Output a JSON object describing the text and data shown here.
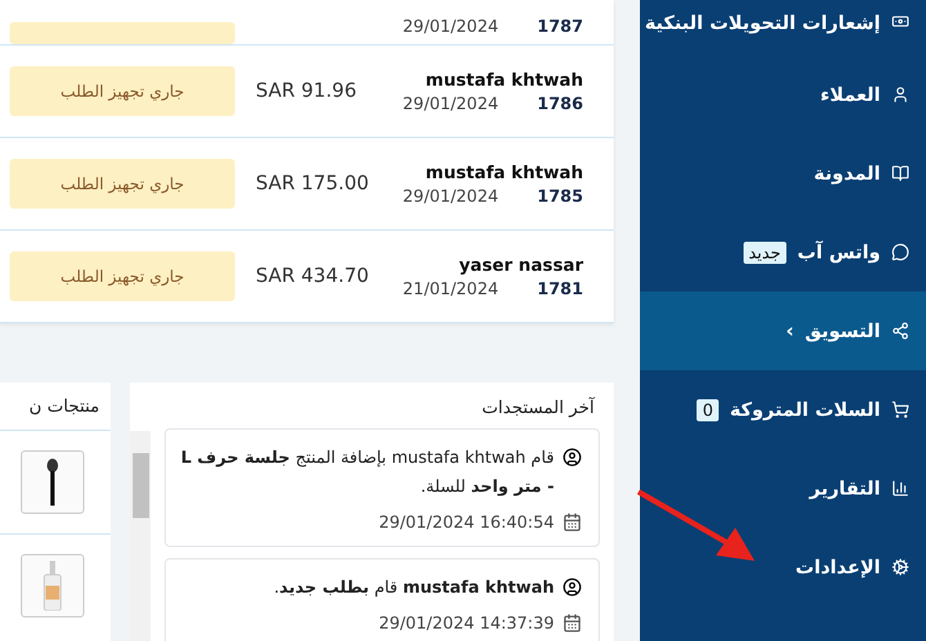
{
  "orders": [
    {
      "kind": "cut",
      "date": "29/01/2024",
      "number": "1787"
    },
    {
      "kind": "full",
      "status": "جاري تجهيز الطلب",
      "amount": "SAR 91.96",
      "name": "mustafa khtwah",
      "date": "29/01/2024",
      "number": "1786"
    },
    {
      "kind": "full",
      "status": "جاري تجهيز الطلب",
      "amount": "SAR 175.00",
      "name": "mustafa khtwah",
      "date": "29/01/2024",
      "number": "1785"
    },
    {
      "kind": "full",
      "status": "جاري تجهيز الطلب",
      "amount": "SAR 434.70",
      "name": "yaser nassar",
      "date": "21/01/2024",
      "number": "1781"
    }
  ],
  "products": {
    "title": "منتجات ن",
    "items": [
      {
        "kind": "brush"
      },
      {
        "kind": "bottle"
      }
    ]
  },
  "updates": {
    "title": "آخر المستجدات",
    "items": [
      {
        "text": "قام mustafa khtwah بإضافة المنتج **جلسة حرف L - متر واحد** للسلة.",
        "time": "16:40:54 29/01/2024"
      },
      {
        "text": "**mustafa khtwah** قام **بطلب جديد**.",
        "time": "14:37:39 29/01/2024"
      }
    ]
  },
  "sidebar": {
    "items": [
      {
        "kind": "money",
        "label": "إشعارات التحويلات البنكية",
        "selected": false
      },
      {
        "kind": "user",
        "label": "العملاء",
        "selected": false
      },
      {
        "kind": "book",
        "label": "المدونة",
        "selected": false
      },
      {
        "kind": "whatsapp",
        "label": "واتس آب",
        "badge": "جديد",
        "selected": false
      },
      {
        "kind": "share",
        "label": "التسويق",
        "chevron": "›",
        "selected": true
      },
      {
        "kind": "cart",
        "label": "السلات المتروكة",
        "badge": "0",
        "selected": false
      },
      {
        "kind": "chart",
        "label": "التقارير",
        "selected": false
      },
      {
        "kind": "cogs",
        "label": "الإعدادات",
        "selected": false
      }
    ]
  },
  "annotation": {
    "kind": "arrow"
  }
}
